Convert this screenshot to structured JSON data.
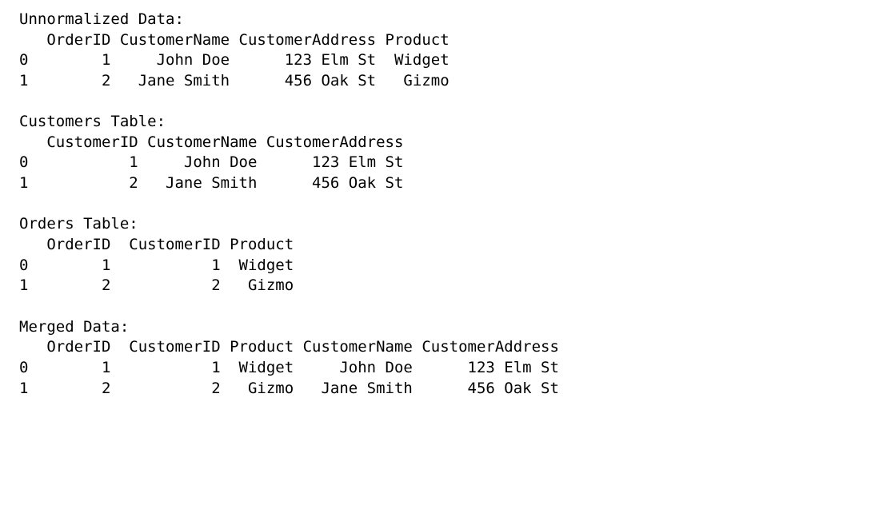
{
  "sections": [
    {
      "title": "Unnormalized Data:",
      "columns": [
        "OrderID",
        "CustomerName",
        "CustomerAddress",
        "Product"
      ],
      "index": [
        "0",
        "1"
      ],
      "rows": [
        [
          "1",
          "John Doe",
          "123 Elm St",
          "Widget"
        ],
        [
          "2",
          "Jane Smith",
          "456 Oak St",
          "Gizmo"
        ]
      ]
    },
    {
      "title": "Customers Table:",
      "columns": [
        "CustomerID",
        "CustomerName",
        "CustomerAddress"
      ],
      "index": [
        "0",
        "1"
      ],
      "rows": [
        [
          "1",
          "John Doe",
          "123 Elm St"
        ],
        [
          "2",
          "Jane Smith",
          "456 Oak St"
        ]
      ]
    },
    {
      "title": "Orders Table:",
      "columns": [
        "OrderID",
        "CustomerID",
        "Product"
      ],
      "index": [
        "0",
        "1"
      ],
      "rows": [
        [
          "1",
          "1",
          "Widget"
        ],
        [
          "2",
          "2",
          "Gizmo"
        ]
      ]
    },
    {
      "title": "Merged Data:",
      "columns": [
        "OrderID",
        "CustomerID",
        "Product",
        "CustomerName",
        "CustomerAddress"
      ],
      "index": [
        "0",
        "1"
      ],
      "rows": [
        [
          "1",
          "1",
          "Widget",
          "John Doe",
          "123 Elm St"
        ],
        [
          "2",
          "2",
          "Gizmo",
          "Jane Smith",
          "456 Oak St"
        ]
      ]
    }
  ],
  "rendered_text": "Unnormalized Data:\n   OrderID CustomerName CustomerAddress Product\n0        1     John Doe      123 Elm St  Widget\n1        2   Jane Smith      456 Oak St   Gizmo\n\nCustomers Table:\n   CustomerID CustomerName CustomerAddress\n0           1     John Doe      123 Elm St\n1           2   Jane Smith      456 Oak St\n\nOrders Table:\n   OrderID  CustomerID Product\n0        1           1  Widget\n1        2           2   Gizmo\n\nMerged Data:\n   OrderID  CustomerID Product CustomerName CustomerAddress\n0        1           1  Widget     John Doe      123 Elm St\n1        2           2   Gizmo   Jane Smith      456 Oak St"
}
